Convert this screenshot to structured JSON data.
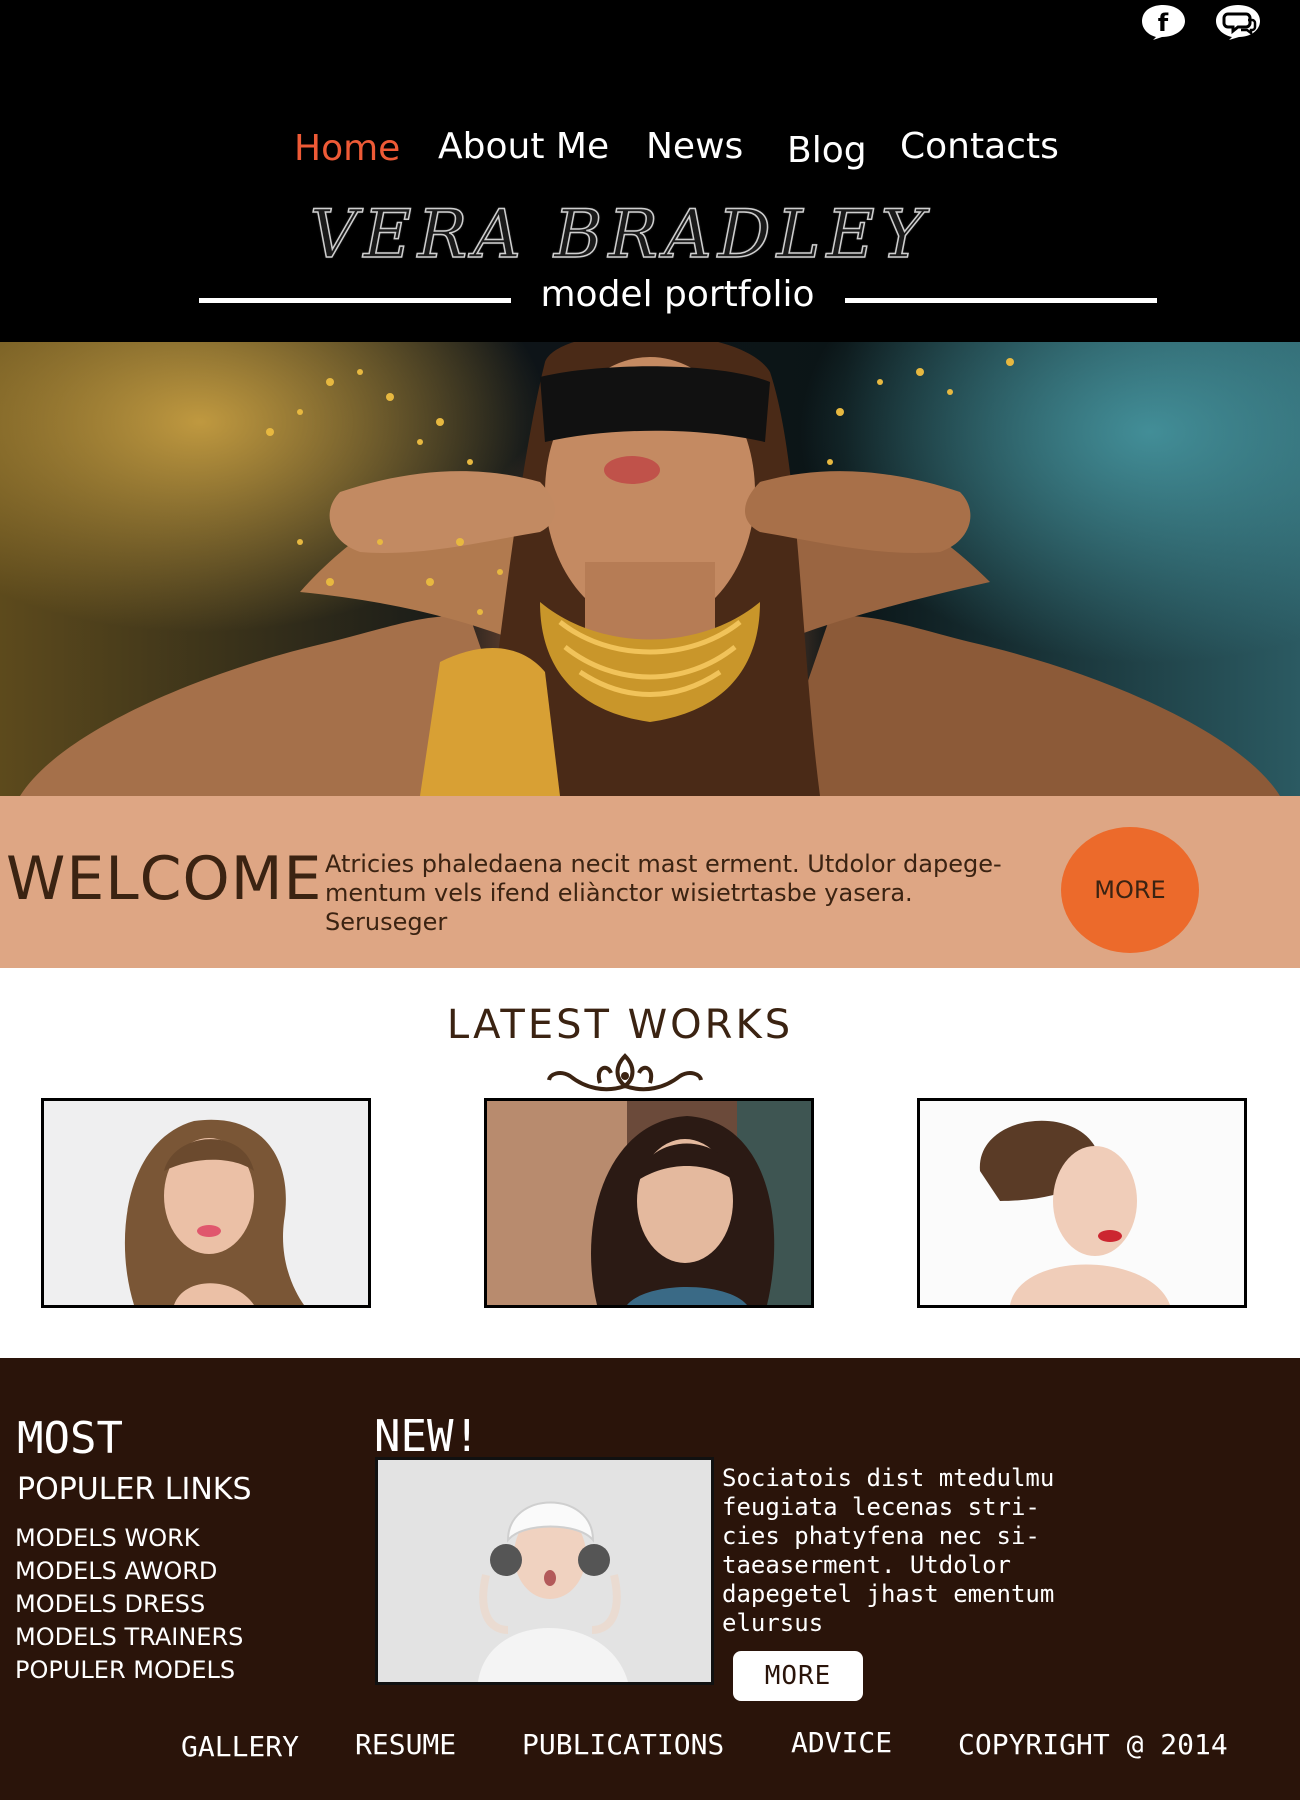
{
  "header": {
    "social": [
      {
        "icon": "facebook-icon",
        "glyph": "f"
      },
      {
        "icon": "chat-bubble-icon"
      }
    ],
    "nav": [
      {
        "label": "Home",
        "active": true
      },
      {
        "label": "About Me"
      },
      {
        "label": "News"
      },
      {
        "label": "Blog"
      },
      {
        "label": "Contacts"
      }
    ],
    "brand": "VERA BRADLEY",
    "tagline": "model portfolio",
    "accent_color": "#ee5a36"
  },
  "welcome": {
    "title": "WELCOME",
    "text": "Atricies phaledaena necit mast erment. Utdolor dapege-mentum vels ifend eliànctor wisietrtasbe yasera. Seruseger",
    "more_label": "MORE",
    "background_color": "#dea684",
    "button_color": "#ec6a2b"
  },
  "works": {
    "title": "LATEST WORKS",
    "ornament_icon": "flourish-ornament-icon"
  },
  "footer": {
    "most_title": "MOST",
    "populer_title": "POPULER LINKS",
    "links": [
      "MODELS WORK",
      "MODELS AWORD",
      "MODELS DRESS",
      "MODELS TRAINERS",
      "POPULER MODELS"
    ],
    "new_title": "NEW!",
    "new_text": "Sociatois dist mtedulmu feugiata lecenas stri-cies phatyfena nec si-taeaserment. Utdolor dapegetel jhast ementum elursus",
    "new_more_label": "MORE",
    "bottom_nav": [
      "GALLERY",
      "RESUME",
      "PUBLICATIONS",
      "ADVICE",
      "COPYRIGHT @ 2014"
    ],
    "background_color": "#2a140a"
  }
}
